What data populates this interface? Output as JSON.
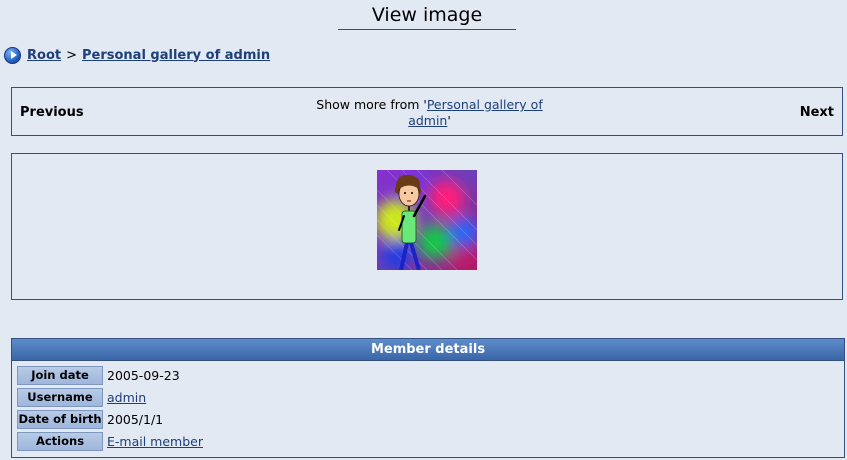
{
  "page": {
    "title": "View image"
  },
  "breadcrumb": {
    "root": "Root",
    "separator": ">",
    "gallery": "Personal gallery of admin"
  },
  "navigation": {
    "previous": "Previous",
    "next": "Next",
    "show_more_prefix": "Show more from '",
    "show_more_link": "Personal gallery of admin",
    "show_more_suffix": "'"
  },
  "image": {
    "alt": "Stick figure on colorful background"
  },
  "member_details": {
    "heading": "Member details",
    "rows": [
      {
        "label": "Join date",
        "value": "2005-09-23"
      },
      {
        "label": "Username",
        "value": "admin"
      },
      {
        "label": "Date of birth",
        "value": "2005/1/1"
      },
      {
        "label": "Actions",
        "value": "E-mail member"
      }
    ]
  },
  "colors": {
    "background": "#e3e9f2",
    "border": "#33507f",
    "header": "#3a66a8",
    "link": "#1d3f7a"
  }
}
